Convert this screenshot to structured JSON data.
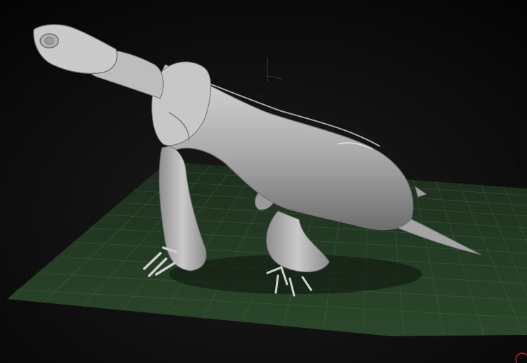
{
  "viewport": {
    "background_gradient": [
      "#0a0a0a",
      "#1c1c1c"
    ],
    "floor_grid_color": "#2c4a2c",
    "floor_line_color": "#4f6e4f",
    "model_color": "#b8b8b8",
    "model_shadow_color": "#5a5a5a",
    "axis_gizmo_color": "#3a3a3a",
    "corner_marker_color": "#c0262b"
  }
}
